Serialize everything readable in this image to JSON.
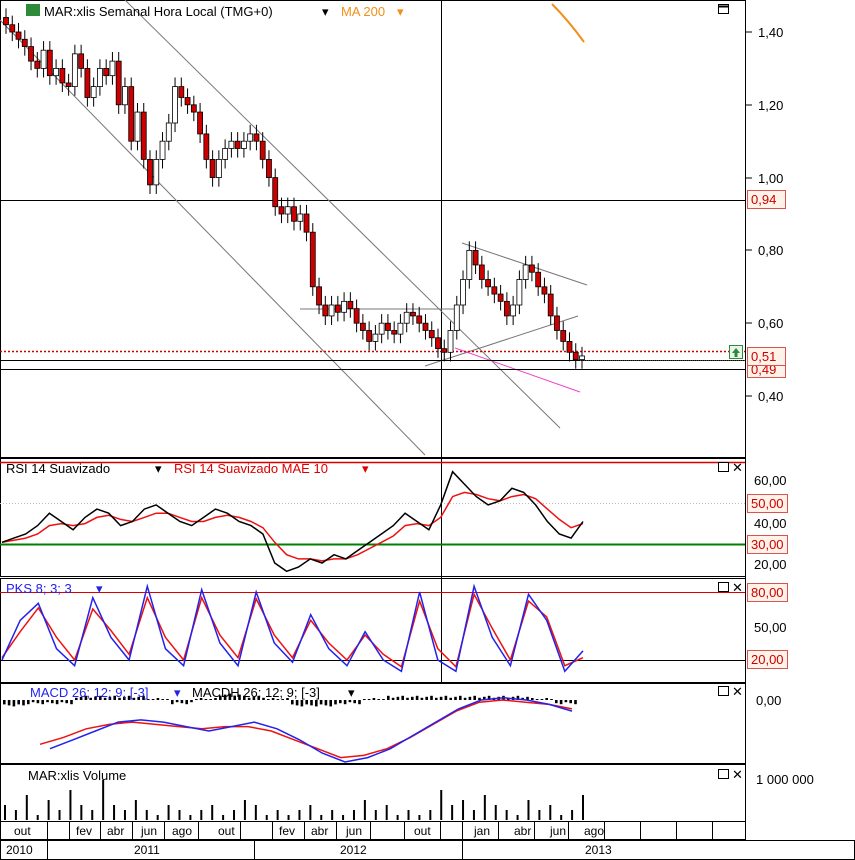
{
  "panels": {
    "price": {
      "title": "MAR:xlis Semanal Hora Local (TMG+0)",
      "overlay": "MA 200",
      "ticks": [
        "1,40",
        "1,20",
        "1,00",
        "0,80",
        "0,60",
        "0,40"
      ],
      "badges": {
        "resistance": "0,94",
        "close": "0,51",
        "support": "0,49"
      }
    },
    "rsi": {
      "title": "RSI 14 Suavizado",
      "overlay": "RSI 14 Suavizado MAE 10",
      "ticks": [
        "60,00",
        "40,00",
        "20,00"
      ],
      "badges": {
        "mid": "50,00",
        "low": "30,00"
      }
    },
    "pks": {
      "title": "PKS 8; 3; 3",
      "ticks": [
        "50,00"
      ],
      "badges": {
        "high": "80,00",
        "low": "20,00"
      }
    },
    "macd": {
      "title": "MACD 26; 12; 9; [-3]",
      "overlay": "MACDH 26; 12; 9; [-3]",
      "ticks": [
        "0,00"
      ]
    },
    "volume": {
      "title": "MAR:xlis Volume",
      "ticks": [
        "1 000 000"
      ]
    }
  },
  "x_axis": {
    "months": [
      "out",
      "fev",
      "abr",
      "jun",
      "ago",
      "out",
      "fev",
      "abr",
      "jun",
      "out",
      "jan",
      "abr",
      "jun",
      "ago"
    ],
    "years": [
      "2010",
      "2011",
      "2012",
      "2013"
    ]
  },
  "colors": {
    "candle_up": "#ffffff",
    "candle_down": "#cc0000",
    "rsi": "#000000",
    "rsi_avg": "#ee1111",
    "pks_k": "#2222ee",
    "pks_d": "#ee1111",
    "ma200": "#f0901a",
    "badge_bg": "#fff2e8",
    "badge_border": "#d9534f",
    "level": "#cc0000",
    "support_line": "#008000"
  },
  "chart_data": [
    {
      "type": "line",
      "title": "MAR:xlis Semanal Hora Local (TMG+0)",
      "x_range": [
        "2010-10",
        "2013-08"
      ],
      "ylim": [
        0.25,
        1.5
      ],
      "series": [
        {
          "name": "MAR:xlis Semanal Hora Local (TMG+0)",
          "approx_weekly_close": [
            1.42,
            1.4,
            1.38,
            1.36,
            1.32,
            1.3,
            1.35,
            1.28,
            1.3,
            1.26,
            1.25,
            1.34,
            1.3,
            1.22,
            1.25,
            1.3,
            1.28,
            1.32,
            1.2,
            1.25,
            1.1,
            1.18,
            1.05,
            0.98,
            1.05,
            1.1,
            1.15,
            1.25,
            1.22,
            1.2,
            1.18,
            1.12,
            1.05,
            1.0,
            1.05,
            1.08,
            1.1,
            1.08,
            1.1,
            1.12,
            1.1,
            1.05,
            1.0,
            0.92,
            0.9,
            0.92,
            0.88,
            0.9,
            0.85,
            0.7,
            0.65,
            0.62,
            0.65,
            0.63,
            0.66,
            0.64,
            0.6,
            0.58,
            0.55,
            0.57,
            0.6,
            0.58,
            0.57,
            0.6,
            0.63,
            0.62,
            0.6,
            0.58,
            0.56,
            0.53,
            0.52,
            0.58,
            0.65,
            0.72,
            0.8,
            0.76,
            0.72,
            0.7,
            0.68,
            0.66,
            0.62,
            0.65,
            0.72,
            0.76,
            0.74,
            0.7,
            0.68,
            0.62,
            0.58,
            0.55,
            0.52,
            0.5,
            0.51
          ]
        },
        {
          "name": "MA 200",
          "segment": "top-right, descending from 1.48 to 1.38"
        }
      ],
      "levels": [
        0.94,
        0.53,
        0.51,
        0.49
      ]
    },
    {
      "type": "line",
      "title": "RSI 14 Suavizado",
      "ylim": [
        10,
        70
      ],
      "levels": [
        70,
        50,
        30
      ],
      "series": [
        {
          "name": "RSI 14 Suavizado",
          "values": [
            30,
            32,
            34,
            38,
            44,
            40,
            36,
            42,
            46,
            44,
            38,
            40,
            46,
            48,
            44,
            40,
            38,
            42,
            46,
            44,
            40,
            38,
            34,
            20,
            16,
            18,
            22,
            20,
            24,
            22,
            26,
            30,
            34,
            38,
            44,
            40,
            36,
            48,
            64,
            58,
            52,
            48,
            50,
            56,
            54,
            48,
            40,
            34,
            32,
            40
          ]
        },
        {
          "name": "RSI 14 Suavizado MAE 10",
          "values": [
            30,
            31,
            32,
            34,
            38,
            39,
            38,
            39,
            42,
            43,
            41,
            40,
            42,
            44,
            44,
            42,
            40,
            40,
            42,
            43,
            42,
            40,
            37,
            30,
            24,
            22,
            22,
            21,
            22,
            22,
            24,
            27,
            30,
            33,
            38,
            39,
            38,
            42,
            52,
            54,
            53,
            51,
            50,
            52,
            53,
            51,
            46,
            41,
            37,
            39
          ]
        }
      ]
    },
    {
      "type": "line",
      "title": "PKS 8; 3; 3",
      "ylim": [
        0,
        100
      ],
      "levels": [
        80,
        20
      ],
      "series": [
        {
          "name": "PKS 8; 3; 3 %K",
          "values": [
            20,
            55,
            70,
            30,
            15,
            75,
            40,
            20,
            85,
            30,
            15,
            82,
            35,
            15,
            80,
            35,
            18,
            60,
            30,
            15,
            45,
            20,
            10,
            80,
            20,
            10,
            85,
            40,
            15,
            78,
            55,
            10,
            28
          ]
        },
        {
          "name": "PKS 8; 3; 3 %D",
          "values": [
            22,
            45,
            66,
            40,
            20,
            65,
            46,
            25,
            75,
            40,
            20,
            75,
            42,
            22,
            74,
            42,
            22,
            55,
            35,
            20,
            42,
            25,
            14,
            72,
            30,
            14,
            78,
            48,
            20,
            72,
            58,
            15,
            22
          ]
        }
      ]
    },
    {
      "type": "line",
      "title": "MACD 26; 12; 9; [-3]",
      "series": [
        {
          "name": "MACD 26; 12; 9; [-3]",
          "values": [
            -0.22,
            -0.18,
            -0.14,
            -0.1,
            -0.09,
            -0.1,
            -0.12,
            -0.14,
            -0.12,
            -0.1,
            -0.13,
            -0.18,
            -0.24,
            -0.28,
            -0.26,
            -0.22,
            -0.16,
            -0.1,
            -0.04,
            0.0,
            0.01,
            0.0,
            -0.02,
            -0.05
          ]
        },
        {
          "name": "MACDH 26; 12; 9; [-3]",
          "values": [
            -0.2,
            -0.17,
            -0.13,
            -0.11,
            -0.1,
            -0.11,
            -0.12,
            -0.13,
            -0.12,
            -0.12,
            -0.14,
            -0.18,
            -0.22,
            -0.26,
            -0.25,
            -0.22,
            -0.17,
            -0.11,
            -0.05,
            -0.01,
            0.0,
            -0.01,
            -0.02,
            -0.04
          ]
        }
      ]
    },
    {
      "type": "bar",
      "title": "MAR:xlis Volume",
      "values": [
        3,
        2,
        5,
        1,
        4,
        2,
        6,
        3,
        2,
        8,
        3,
        2,
        4,
        2,
        1,
        3,
        2,
        1,
        2,
        3,
        1,
        2,
        4,
        3,
        1,
        2,
        1,
        2,
        3,
        1,
        2,
        1,
        2,
        4,
        2,
        3,
        1,
        2,
        1,
        2,
        6,
        3,
        4,
        2,
        5,
        3,
        2,
        1,
        4,
        2,
        3,
        1,
        2,
        5
      ]
    }
  ]
}
